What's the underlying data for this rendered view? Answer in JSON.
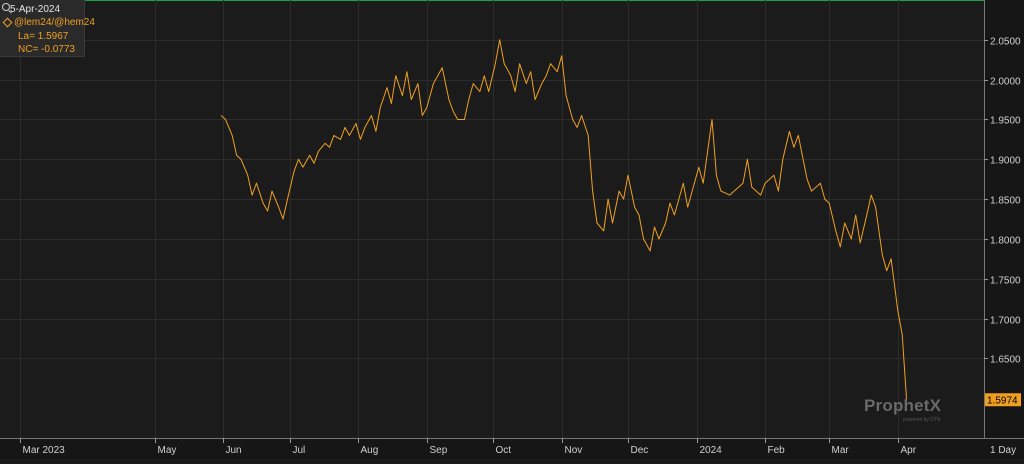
{
  "info": {
    "date": "5-Apr-2024",
    "symbol": "@lem24/@hem24",
    "last": "La= 1.5967",
    "net_change": "NC= -0.0773"
  },
  "logo": {
    "name": "ProphetX",
    "sub": "powered by DTN"
  },
  "timeframe": "1 Day",
  "colors": {
    "line": "#f0a020",
    "grid": "#2d2d2d",
    "background": "#1b1b1b",
    "green_line": "#1aa34a"
  },
  "chart_data": {
    "type": "line",
    "title": "",
    "xlabel": "",
    "ylabel": "",
    "ylim": [
      1.55,
      2.1
    ],
    "y_ticks": [
      "2.0500",
      "2.0000",
      "1.9500",
      "1.9000",
      "1.8500",
      "1.8000",
      "1.7500",
      "1.7000",
      "1.6500"
    ],
    "y_tick_values": [
      2.05,
      2.0,
      1.95,
      1.9,
      1.85,
      1.8,
      1.75,
      1.7,
      1.65
    ],
    "x_ticks": [
      "Mar 2023",
      "May",
      "Jun",
      "Jul",
      "Aug",
      "Sep",
      "Oct",
      "Nov",
      "Dec",
      "2024",
      "Feb",
      "Mar",
      "Apr"
    ],
    "x_tick_dates": [
      "2023-03-01",
      "2023-05-01",
      "2023-06-01",
      "2023-07-01",
      "2023-08-01",
      "2023-09-01",
      "2023-10-01",
      "2023-11-01",
      "2023-12-01",
      "2024-01-01",
      "2024-02-01",
      "2024-03-01",
      "2024-04-01"
    ],
    "xlim": [
      "2023-02-20",
      "2024-05-10"
    ],
    "last_value_label": "1.5974",
    "last_value": 1.5974,
    "grid": true,
    "series": [
      {
        "points": [
          [
            "2023-05-31",
            1.955
          ],
          [
            "2023-06-02",
            1.95
          ],
          [
            "2023-06-05",
            1.93
          ],
          [
            "2023-06-07",
            1.905
          ],
          [
            "2023-06-09",
            1.9
          ],
          [
            "2023-06-12",
            1.88
          ],
          [
            "2023-06-14",
            1.855
          ],
          [
            "2023-06-16",
            1.87
          ],
          [
            "2023-06-19",
            1.845
          ],
          [
            "2023-06-21",
            1.835
          ],
          [
            "2023-06-23",
            1.86
          ],
          [
            "2023-06-26",
            1.84
          ],
          [
            "2023-06-28",
            1.825
          ],
          [
            "2023-06-30",
            1.85
          ],
          [
            "2023-07-03",
            1.885
          ],
          [
            "2023-07-05",
            1.9
          ],
          [
            "2023-07-07",
            1.89
          ],
          [
            "2023-07-10",
            1.905
          ],
          [
            "2023-07-12",
            1.895
          ],
          [
            "2023-07-14",
            1.91
          ],
          [
            "2023-07-17",
            1.92
          ],
          [
            "2023-07-19",
            1.915
          ],
          [
            "2023-07-21",
            1.93
          ],
          [
            "2023-07-24",
            1.925
          ],
          [
            "2023-07-26",
            1.94
          ],
          [
            "2023-07-28",
            1.93
          ],
          [
            "2023-07-31",
            1.945
          ],
          [
            "2023-08-02",
            1.925
          ],
          [
            "2023-08-04",
            1.94
          ],
          [
            "2023-08-07",
            1.955
          ],
          [
            "2023-08-09",
            1.935
          ],
          [
            "2023-08-11",
            1.965
          ],
          [
            "2023-08-14",
            1.99
          ],
          [
            "2023-08-16",
            1.97
          ],
          [
            "2023-08-18",
            2.005
          ],
          [
            "2023-08-21",
            1.98
          ],
          [
            "2023-08-23",
            2.01
          ],
          [
            "2023-08-25",
            1.975
          ],
          [
            "2023-08-28",
            1.995
          ],
          [
            "2023-08-30",
            1.955
          ],
          [
            "2023-09-01",
            1.965
          ],
          [
            "2023-09-04",
            1.995
          ],
          [
            "2023-09-06",
            2.005
          ],
          [
            "2023-09-08",
            2.015
          ],
          [
            "2023-09-11",
            1.975
          ],
          [
            "2023-09-13",
            1.96
          ],
          [
            "2023-09-15",
            1.95
          ],
          [
            "2023-09-18",
            1.95
          ],
          [
            "2023-09-20",
            1.975
          ],
          [
            "2023-09-22",
            1.995
          ],
          [
            "2023-09-25",
            1.985
          ],
          [
            "2023-09-27",
            2.005
          ],
          [
            "2023-09-29",
            1.985
          ],
          [
            "2023-10-02",
            2.02
          ],
          [
            "2023-10-04",
            2.05
          ],
          [
            "2023-10-06",
            2.02
          ],
          [
            "2023-10-09",
            2.005
          ],
          [
            "2023-10-11",
            1.985
          ],
          [
            "2023-10-13",
            2.02
          ],
          [
            "2023-10-16",
            1.995
          ],
          [
            "2023-10-18",
            2.01
          ],
          [
            "2023-10-20",
            1.975
          ],
          [
            "2023-10-23",
            1.995
          ],
          [
            "2023-10-25",
            2.005
          ],
          [
            "2023-10-27",
            2.02
          ],
          [
            "2023-10-30",
            2.01
          ],
          [
            "2023-11-01",
            2.03
          ],
          [
            "2023-11-03",
            1.98
          ],
          [
            "2023-11-06",
            1.95
          ],
          [
            "2023-11-08",
            1.94
          ],
          [
            "2023-11-10",
            1.955
          ],
          [
            "2023-11-13",
            1.93
          ],
          [
            "2023-11-15",
            1.86
          ],
          [
            "2023-11-17",
            1.82
          ],
          [
            "2023-11-20",
            1.81
          ],
          [
            "2023-11-22",
            1.85
          ],
          [
            "2023-11-24",
            1.82
          ],
          [
            "2023-11-27",
            1.86
          ],
          [
            "2023-11-29",
            1.85
          ],
          [
            "2023-12-01",
            1.88
          ],
          [
            "2023-12-04",
            1.84
          ],
          [
            "2023-12-06",
            1.83
          ],
          [
            "2023-12-08",
            1.8
          ],
          [
            "2023-12-11",
            1.785
          ],
          [
            "2023-12-13",
            1.815
          ],
          [
            "2023-12-15",
            1.8
          ],
          [
            "2023-12-18",
            1.82
          ],
          [
            "2023-12-20",
            1.845
          ],
          [
            "2023-12-22",
            1.83
          ],
          [
            "2023-12-26",
            1.87
          ],
          [
            "2023-12-28",
            1.84
          ],
          [
            "2024-01-02",
            1.89
          ],
          [
            "2024-01-04",
            1.87
          ],
          [
            "2024-01-08",
            1.95
          ],
          [
            "2024-01-10",
            1.88
          ],
          [
            "2024-01-12",
            1.86
          ],
          [
            "2024-01-16",
            1.855
          ],
          [
            "2024-01-18",
            1.86
          ],
          [
            "2024-01-22",
            1.87
          ],
          [
            "2024-01-24",
            1.9
          ],
          [
            "2024-01-26",
            1.865
          ],
          [
            "2024-01-30",
            1.855
          ],
          [
            "2024-02-01",
            1.87
          ],
          [
            "2024-02-05",
            1.88
          ],
          [
            "2024-02-07",
            1.86
          ],
          [
            "2024-02-09",
            1.9
          ],
          [
            "2024-02-12",
            1.935
          ],
          [
            "2024-02-14",
            1.915
          ],
          [
            "2024-02-16",
            1.93
          ],
          [
            "2024-02-20",
            1.875
          ],
          [
            "2024-02-22",
            1.86
          ],
          [
            "2024-02-26",
            1.87
          ],
          [
            "2024-02-28",
            1.85
          ],
          [
            "2024-03-01",
            1.845
          ],
          [
            "2024-03-04",
            1.81
          ],
          [
            "2024-03-06",
            1.79
          ],
          [
            "2024-03-08",
            1.82
          ],
          [
            "2024-03-11",
            1.8
          ],
          [
            "2024-03-13",
            1.83
          ],
          [
            "2024-03-15",
            1.795
          ],
          [
            "2024-03-18",
            1.83
          ],
          [
            "2024-03-20",
            1.855
          ],
          [
            "2024-03-22",
            1.84
          ],
          [
            "2024-03-25",
            1.78
          ],
          [
            "2024-03-27",
            1.76
          ],
          [
            "2024-03-29",
            1.775
          ],
          [
            "2024-04-01",
            1.71
          ],
          [
            "2024-04-03",
            1.68
          ],
          [
            "2024-04-05",
            1.5974
          ]
        ]
      }
    ]
  }
}
